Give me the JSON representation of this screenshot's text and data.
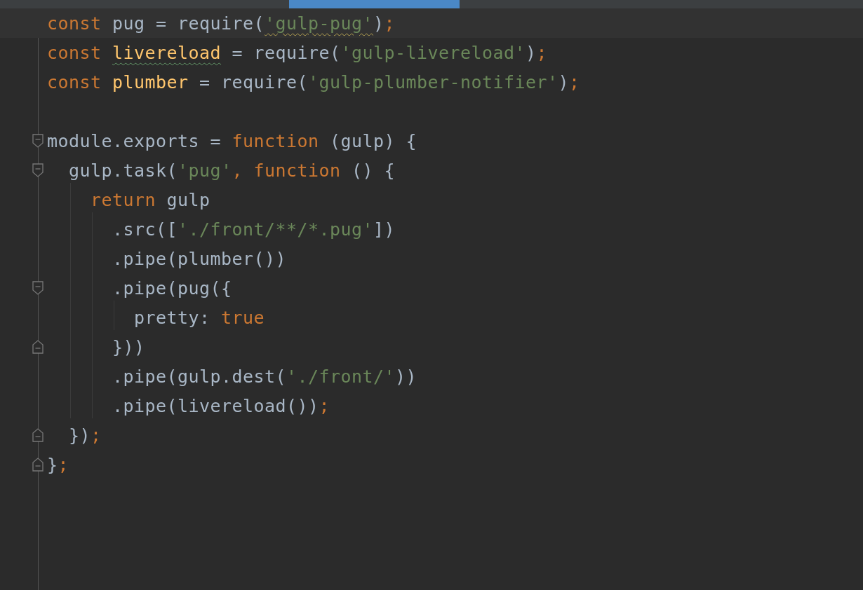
{
  "editor": {
    "lines": [
      {
        "current": true,
        "fold_start": false,
        "fold_end": false,
        "tokens": [
          {
            "kind": "keyword",
            "text": "const "
          },
          {
            "kind": "plain",
            "text": "pug = require("
          },
          {
            "kind": "string-warning",
            "text": "'gulp-pug'"
          },
          {
            "kind": "plain",
            "text": ")"
          },
          {
            "kind": "keyword",
            "text": ";"
          }
        ]
      },
      {
        "current": false,
        "fold_start": false,
        "fold_end": false,
        "tokens": [
          {
            "kind": "keyword",
            "text": "const "
          },
          {
            "kind": "ident-typo",
            "text": "livereload"
          },
          {
            "kind": "plain",
            "text": " = require("
          },
          {
            "kind": "string",
            "text": "'gulp-livereload'"
          },
          {
            "kind": "plain",
            "text": ")"
          },
          {
            "kind": "keyword",
            "text": ";"
          }
        ]
      },
      {
        "current": false,
        "fold_start": false,
        "fold_end": false,
        "tokens": [
          {
            "kind": "keyword",
            "text": "const "
          },
          {
            "kind": "ident",
            "text": "plumber"
          },
          {
            "kind": "plain",
            "text": " = require("
          },
          {
            "kind": "string",
            "text": "'gulp-plumber-notifier'"
          },
          {
            "kind": "plain",
            "text": ")"
          },
          {
            "kind": "keyword",
            "text": ";"
          }
        ]
      },
      {
        "current": false,
        "fold_start": false,
        "fold_end": false
      },
      {
        "current": false,
        "fold_start": true,
        "fold_end": false,
        "tokens": [
          {
            "kind": "plain",
            "text": "module.exports = "
          },
          {
            "kind": "keyword",
            "text": "function "
          },
          {
            "kind": "plain",
            "text": "(gulp) {"
          }
        ]
      },
      {
        "current": false,
        "fold_start": true,
        "fold_end": false,
        "tokens": [
          {
            "kind": "plain",
            "text": "  gulp.task("
          },
          {
            "kind": "string",
            "text": "'pug'"
          },
          {
            "kind": "keyword",
            "text": ", function "
          },
          {
            "kind": "plain",
            "text": "() {"
          }
        ]
      },
      {
        "current": false,
        "fold_start": false,
        "fold_end": false,
        "tokens": [
          {
            "kind": "keyword",
            "text": "    return "
          },
          {
            "kind": "plain",
            "text": "gulp"
          }
        ]
      },
      {
        "current": false,
        "fold_start": false,
        "fold_end": false,
        "tokens": [
          {
            "kind": "plain",
            "text": "      .src(["
          },
          {
            "kind": "string",
            "text": "'./front/**/*.pug'"
          },
          {
            "kind": "plain",
            "text": "])"
          }
        ]
      },
      {
        "current": false,
        "fold_start": false,
        "fold_end": false,
        "tokens": [
          {
            "kind": "plain",
            "text": "      .pipe(plumber())"
          }
        ]
      },
      {
        "current": false,
        "fold_start": true,
        "fold_end": false,
        "tokens": [
          {
            "kind": "plain",
            "text": "      .pipe(pug({"
          }
        ]
      },
      {
        "current": false,
        "fold_start": false,
        "fold_end": false,
        "tokens": [
          {
            "kind": "plain",
            "text": "        pretty: "
          },
          {
            "kind": "keyword",
            "text": "true"
          }
        ]
      },
      {
        "current": false,
        "fold_start": false,
        "fold_end": true,
        "tokens": [
          {
            "kind": "plain",
            "text": "      }))"
          }
        ]
      },
      {
        "current": false,
        "fold_start": false,
        "fold_end": false,
        "tokens": [
          {
            "kind": "plain",
            "text": "      .pipe(gulp.dest("
          },
          {
            "kind": "string",
            "text": "'./front/'"
          },
          {
            "kind": "plain",
            "text": "))"
          }
        ]
      },
      {
        "current": false,
        "fold_start": false,
        "fold_end": false,
        "tokens": [
          {
            "kind": "plain",
            "text": "      .pipe(livereload())"
          },
          {
            "kind": "keyword",
            "text": ";"
          }
        ]
      },
      {
        "current": false,
        "fold_start": false,
        "fold_end": true,
        "tokens": [
          {
            "kind": "plain",
            "text": "  })"
          },
          {
            "kind": "keyword",
            "text": ";"
          }
        ]
      },
      {
        "current": false,
        "fold_start": false,
        "fold_end": true,
        "tokens": [
          {
            "kind": "plain",
            "text": "}"
          },
          {
            "kind": "keyword",
            "text": ";"
          }
        ]
      }
    ]
  }
}
